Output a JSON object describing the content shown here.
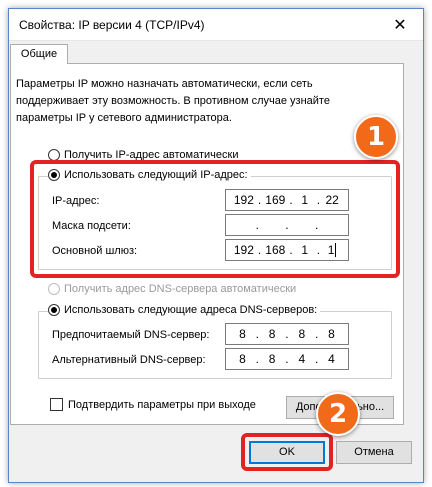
{
  "window": {
    "title": "Свойства: IP версии 4 (TCP/IPv4)",
    "close_glyph": "✕"
  },
  "tabs": [
    {
      "label": "Общие",
      "selected": true
    }
  ],
  "info_text": "Параметры IP можно назначать автоматически, если сеть поддерживает эту возможность. В противном случае узнайте параметры IP у сетевого администратора.",
  "ip_mode": {
    "auto_label": "Получить IP-адрес автоматически",
    "manual_label": "Использовать следующий IP-адрес:",
    "selected": "manual"
  },
  "ip_fields": {
    "ip_label": "IP-адрес:",
    "ip_value": [
      "192",
      "169",
      "1",
      "22"
    ],
    "mask_label": "Маска подсети:",
    "mask_value": [
      "",
      "",
      "",
      ""
    ],
    "gateway_label": "Основной шлюз:",
    "gateway_value": [
      "192",
      "168",
      "1",
      "1"
    ]
  },
  "dns_mode": {
    "auto_label": "Получить адрес DNS-сервера автоматически",
    "manual_label": "Использовать следующие адреса DNS-серверов:",
    "selected": "manual"
  },
  "dns_fields": {
    "preferred_label": "Предпочитаемый DNS-сервер:",
    "preferred_value": [
      "8",
      "8",
      "8",
      "8"
    ],
    "alternate_label": "Альтернативный DNS-сервер:",
    "alternate_value": [
      "8",
      "8",
      "4",
      "4"
    ]
  },
  "validate_on_exit": {
    "label": "Подтвердить параметры при выходе",
    "checked": false
  },
  "buttons": {
    "advanced_label": "Дополнительно...",
    "ok_label": "OK",
    "cancel_label": "Отмена"
  },
  "annotations": {
    "badge_1": "1",
    "badge_2": "2",
    "highlight_color": "#e52222",
    "badge_color": "#f06a1a"
  }
}
